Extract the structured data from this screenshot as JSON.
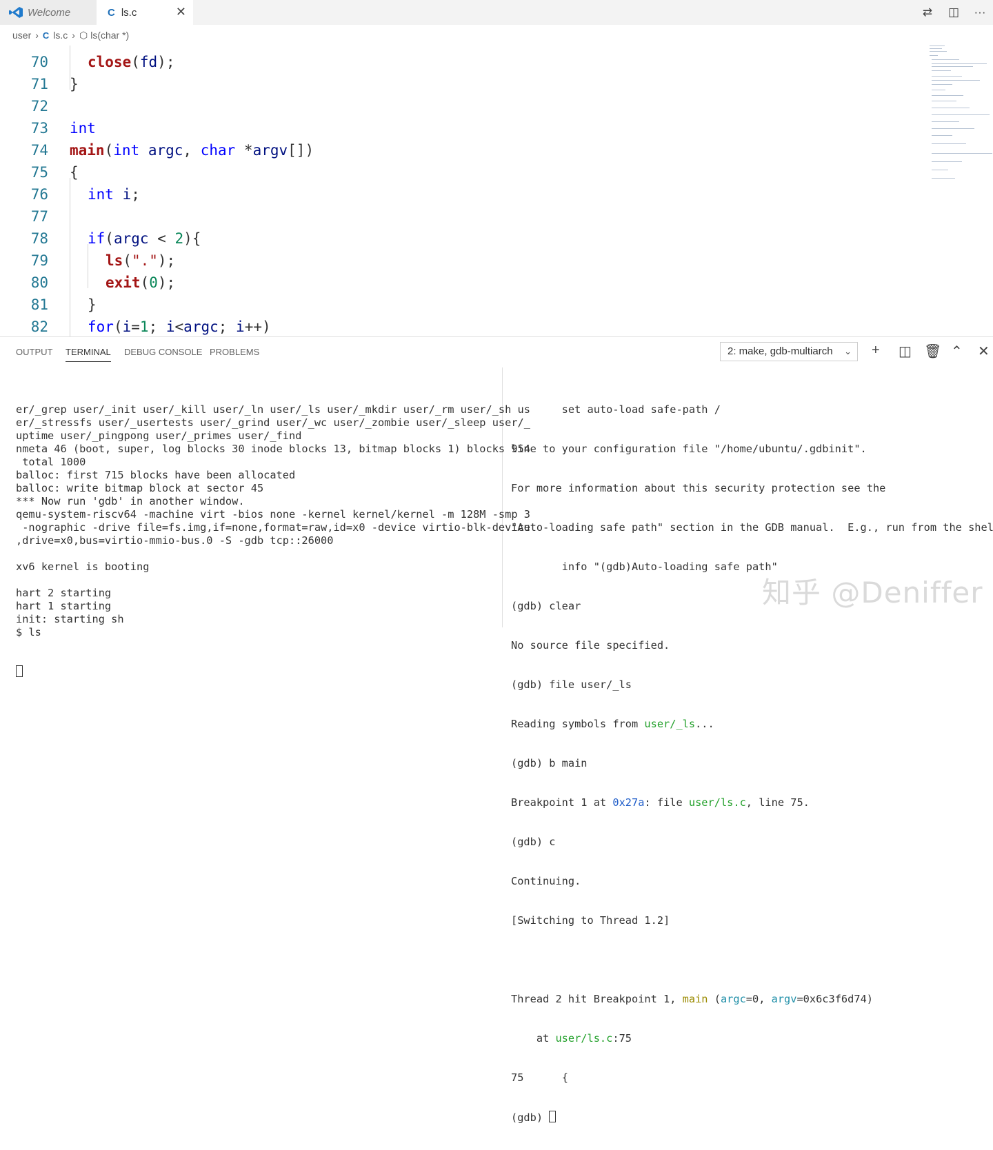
{
  "tabs": [
    {
      "label": "Welcome",
      "active": false
    },
    {
      "label": "ls.c",
      "icon": "c-file-icon",
      "active": true
    }
  ],
  "breadcrumb": {
    "folder": "user",
    "file": "ls.c",
    "symbol": "ls(char *)"
  },
  "editor": {
    "lines": [
      {
        "n": "70",
        "indent": 1,
        "code": "close(fd);"
      },
      {
        "n": "71",
        "indent": 0,
        "code": "}"
      },
      {
        "n": "72",
        "indent": 0,
        "code": ""
      },
      {
        "n": "73",
        "indent": 0,
        "code": "int"
      },
      {
        "n": "74",
        "indent": 0,
        "code": "main(int argc, char *argv[])"
      },
      {
        "n": "75",
        "indent": 0,
        "code": "{"
      },
      {
        "n": "76",
        "indent": 1,
        "code": "int i;"
      },
      {
        "n": "77",
        "indent": 0,
        "code": ""
      },
      {
        "n": "78",
        "indent": 1,
        "code": "if(argc < 2){"
      },
      {
        "n": "79",
        "indent": 2,
        "code": "ls(\".\");"
      },
      {
        "n": "80",
        "indent": 2,
        "code": "exit(0);"
      },
      {
        "n": "81",
        "indent": 1,
        "code": "}"
      },
      {
        "n": "82",
        "indent": 1,
        "code": "for(i=1; i<argc; i++)"
      }
    ]
  },
  "panel": {
    "tabs": [
      "OUTPUT",
      "TERMINAL",
      "DEBUG CONSOLE",
      "PROBLEMS"
    ],
    "active_tab": "TERMINAL",
    "terminal_select": "2: make, gdb-multiarch",
    "left_terminal": [
      "er/_grep user/_init user/_kill user/_ln user/_ls user/_mkdir user/_rm user/_sh us",
      "er/_stressfs user/_usertests user/_grind user/_wc user/_zombie user/_sleep user/_",
      "uptime user/_pingpong user/_primes user/_find",
      "nmeta 46 (boot, super, log blocks 30 inode blocks 13, bitmap blocks 1) blocks 954",
      " total 1000",
      "balloc: first 715 blocks have been allocated",
      "balloc: write bitmap block at sector 45",
      "*** Now run 'gdb' in another window.",
      "qemu-system-riscv64 -machine virt -bios none -kernel kernel/kernel -m 128M -smp 3",
      " -nographic -drive file=fs.img,if=none,format=raw,id=x0 -device virtio-blk-device",
      ",drive=x0,bus=virtio-mmio-bus.0 -S -gdb tcp::26000",
      "",
      "xv6 kernel is booting",
      "",
      "hart 2 starting",
      "hart 1 starting",
      "init: starting sh",
      "$ ls"
    ],
    "right_terminal": {
      "l1": "        set auto-load safe-path /",
      "l2": "line to your configuration file \"/home/ubuntu/.gdbinit\".",
      "l3": "For more information about this security protection see the",
      "l4": "\"Auto-loading safe path\" section in the GDB manual.  E.g., run from the shell:",
      "l5": "        info \"(gdb)Auto-loading safe path\"",
      "l6": "(gdb) clear",
      "l7": "No source file specified.",
      "l8": "(gdb) file user/_ls",
      "l9a": "Reading symbols from ",
      "l9b": "user/_ls",
      "l9c": "...",
      "l10": "(gdb) b main",
      "l11a": "Breakpoint 1 at ",
      "l11b": "0x27a",
      "l11c": ": file ",
      "l11d": "user/ls.c",
      "l11e": ", line 75.",
      "l12": "(gdb) c",
      "l13": "Continuing.",
      "l14": "[Switching to Thread 1.2]",
      "l16a": "Thread 2 hit Breakpoint 1, ",
      "l16b": "main",
      "l16c": " (",
      "l16d": "argc",
      "l16e": "=0, ",
      "l16f": "argv",
      "l16g": "=0x6c3f6d74)",
      "l17a": "    at ",
      "l17b": "user/ls.c",
      "l17c": ":75",
      "l18": "75\t{",
      "l19": "(gdb) "
    }
  },
  "watermark": "知乎 @Deniffer"
}
